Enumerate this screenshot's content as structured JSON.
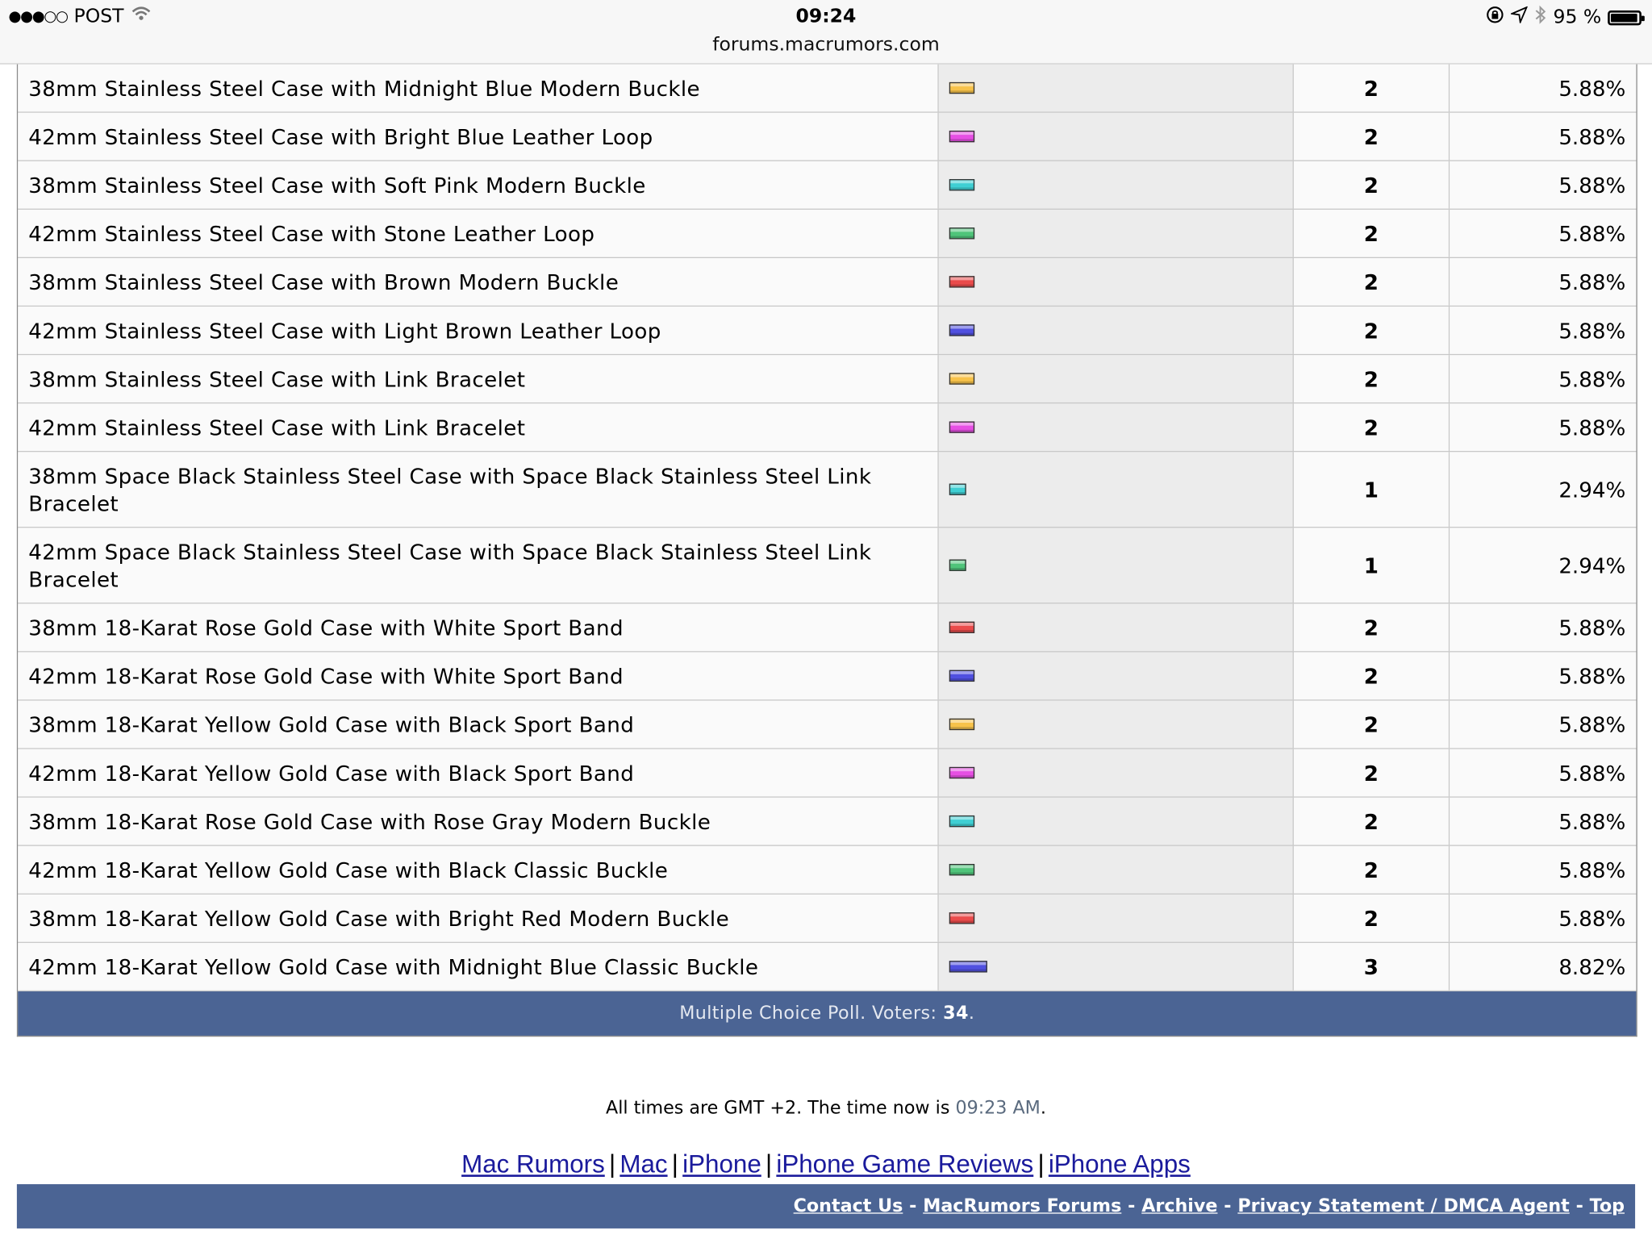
{
  "status": {
    "carrier": "POST",
    "time": "09:24",
    "url": "forums.macrumors.com",
    "battery": "95 %",
    "battery_level": 0.95
  },
  "poll": {
    "rows": [
      {
        "option": "38mm Stainless Steel Case with Midnight Blue Modern Buckle",
        "votes": "2",
        "percent": "5.88%",
        "share": 5.88,
        "color": "#f7c24a"
      },
      {
        "option": "42mm Stainless Steel Case with Bright Blue Leather Loop",
        "votes": "2",
        "percent": "5.88%",
        "share": 5.88,
        "color": "#e64fe3"
      },
      {
        "option": "38mm Stainless Steel Case with Soft Pink Modern Buckle",
        "votes": "2",
        "percent": "5.88%",
        "share": 5.88,
        "color": "#3fcfd3"
      },
      {
        "option": "42mm Stainless Steel Case with Stone Leather Loop",
        "votes": "2",
        "percent": "5.88%",
        "share": 5.88,
        "color": "#4fc47a"
      },
      {
        "option": "38mm Stainless Steel Case with Brown Modern Buckle",
        "votes": "2",
        "percent": "5.88%",
        "share": 5.88,
        "color": "#ea4b4b"
      },
      {
        "option": "42mm Stainless Steel Case with Light Brown Leather Loop",
        "votes": "2",
        "percent": "5.88%",
        "share": 5.88,
        "color": "#5050e0"
      },
      {
        "option": "38mm Stainless Steel Case with Link Bracelet",
        "votes": "2",
        "percent": "5.88%",
        "share": 5.88,
        "color": "#f7c24a"
      },
      {
        "option": "42mm Stainless Steel Case with Link Bracelet",
        "votes": "2",
        "percent": "5.88%",
        "share": 5.88,
        "color": "#e64fe3"
      },
      {
        "option": "38mm Space Black Stainless Steel Case with Space Black Stainless Steel Link Bracelet",
        "votes": "1",
        "percent": "2.94%",
        "share": 2.94,
        "color": "#3fcfd3",
        "tall": true
      },
      {
        "option": "42mm Space Black Stainless Steel Case with Space Black Stainless Steel Link Bracelet",
        "votes": "1",
        "percent": "2.94%",
        "share": 2.94,
        "color": "#4fc47a",
        "tall": true
      },
      {
        "option": "38mm 18-Karat Rose Gold Case with White Sport Band",
        "votes": "2",
        "percent": "5.88%",
        "share": 5.88,
        "color": "#ea4b4b"
      },
      {
        "option": "42mm 18-Karat Rose Gold Case with White Sport Band",
        "votes": "2",
        "percent": "5.88%",
        "share": 5.88,
        "color": "#5050e0"
      },
      {
        "option": "38mm 18-Karat Yellow Gold Case with Black Sport Band",
        "votes": "2",
        "percent": "5.88%",
        "share": 5.88,
        "color": "#f7c24a"
      },
      {
        "option": "42mm 18-Karat Yellow Gold Case with Black Sport Band",
        "votes": "2",
        "percent": "5.88%",
        "share": 5.88,
        "color": "#e64fe3"
      },
      {
        "option": "38mm 18-Karat Rose Gold Case with Rose Gray Modern Buckle",
        "votes": "2",
        "percent": "5.88%",
        "share": 5.88,
        "color": "#3fcfd3"
      },
      {
        "option": "42mm 18-Karat Yellow Gold Case with Black Classic Buckle",
        "votes": "2",
        "percent": "5.88%",
        "share": 5.88,
        "color": "#4fc47a"
      },
      {
        "option": "38mm 18-Karat Yellow Gold Case with Bright Red Modern Buckle",
        "votes": "2",
        "percent": "5.88%",
        "share": 5.88,
        "color": "#ea4b4b"
      },
      {
        "option": "42mm 18-Karat Yellow Gold Case with Midnight Blue Classic Buckle",
        "votes": "3",
        "percent": "8.82%",
        "share": 8.82,
        "color": "#5050e0"
      }
    ],
    "footer_text": "Multiple Choice Poll. Voters:",
    "voters": "34",
    "footer_end": "."
  },
  "times": {
    "prefix": "All times are GMT +2. The time now is",
    "time": "09:23 AM",
    "suffix": "."
  },
  "links": [
    "Mac Rumors",
    "Mac",
    "iPhone",
    "iPhone Game Reviews",
    "iPhone Apps"
  ],
  "bottom_links": [
    "Contact Us",
    "MacRumors Forums",
    "Archive",
    "Privacy Statement / DMCA Agent",
    "Top"
  ],
  "colors": {
    "header_blue": "#4b6494",
    "link_blue": "#1a1a9c"
  }
}
